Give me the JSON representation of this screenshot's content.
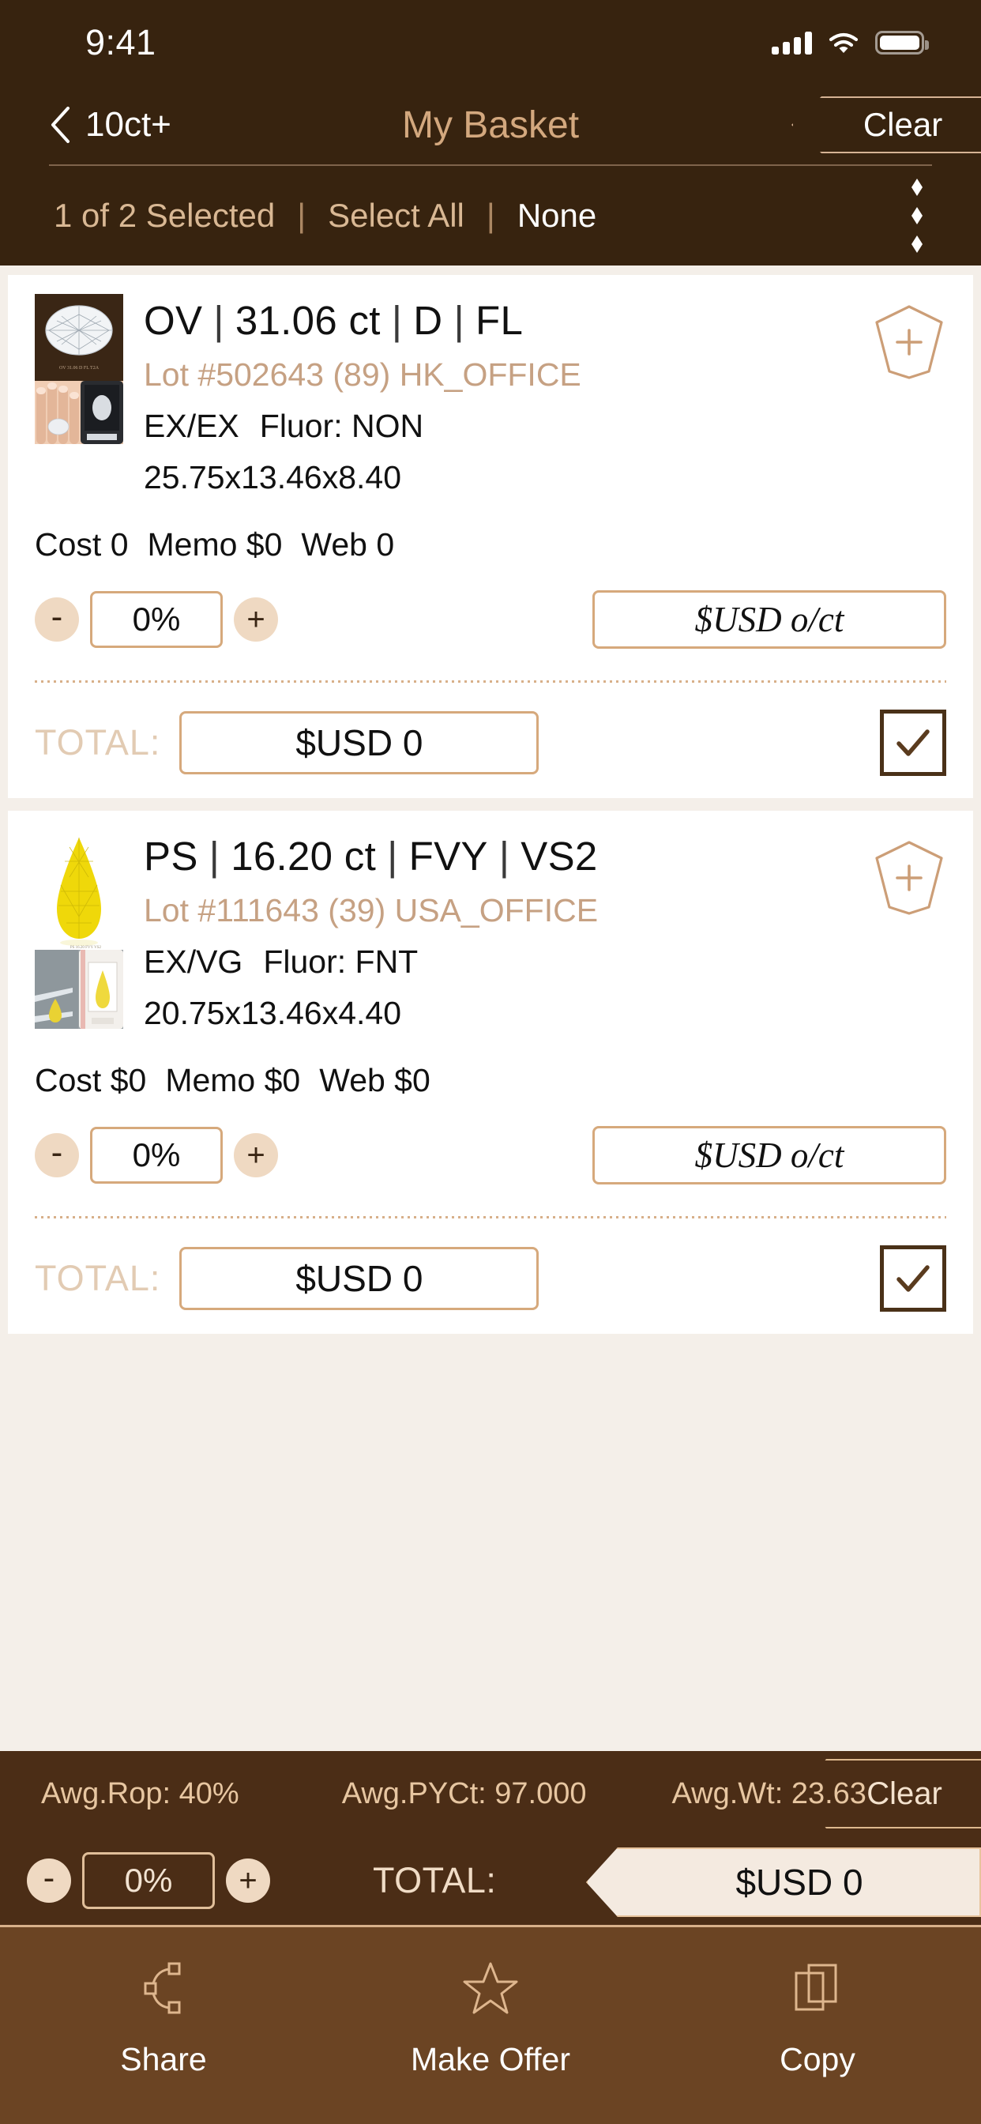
{
  "status_bar": {
    "time": "9:41",
    "signal_icon": "cellular-bars-icon",
    "wifi_icon": "wifi-icon",
    "battery_icon": "battery-icon"
  },
  "nav": {
    "back_label": "10ct+",
    "back_icon": "chevron-left-icon",
    "title": "My Basket",
    "clear_label": "Clear"
  },
  "select_bar": {
    "selected_count_label": "1 of 2 Selected",
    "separator": "|",
    "select_all_label": "Select All",
    "none_label": "None",
    "menu_icon": "kebab-diamond-menu-icon"
  },
  "cards": [
    {
      "shape": "OV",
      "carat": "31.06 ct",
      "color": "D",
      "clarity": "FL",
      "pipe": "|",
      "lot": "Lot #502643 (89) HK_OFFICE",
      "cut_polish": "EX/EX",
      "fluor": "Fluor: NON",
      "measurements": "25.75x13.46x8.40",
      "cost": "Cost 0",
      "memo": "Memo $0",
      "web": "Web 0",
      "minus": "-",
      "percent": "0%",
      "plus": "+",
      "usd_per_ct": "$USD o/ct",
      "total_label": "TOTAL:",
      "total_value": "$USD 0",
      "checked": true,
      "add_icon": "gem-plus-icon",
      "thumb_top_icon": "oval-diamond-thumbnail",
      "thumb_bottom_icon": "hand-holding-diamond-photo"
    },
    {
      "shape": "PS",
      "carat": "16.20 ct",
      "color": "FVY",
      "clarity": "VS2",
      "pipe": "|",
      "lot": "Lot #111643 (39) USA_OFFICE",
      "cut_polish": "EX/VG",
      "fluor": "Fluor: FNT",
      "measurements": "20.75x13.46x4.40",
      "cost": "Cost $0",
      "memo": "Memo $0",
      "web": "Web $0",
      "minus": "-",
      "percent": "0%",
      "plus": "+",
      "usd_per_ct": "$USD o/ct",
      "total_label": "TOTAL:",
      "total_value": "$USD 0",
      "checked": true,
      "add_icon": "gem-plus-icon",
      "thumb_top_icon": "pear-yellow-diamond-thumbnail",
      "thumb_bottom_icon": "tweezers-diamond-photo"
    }
  ],
  "summary": {
    "avg_rop": "Awg.Rop: 40%",
    "avg_pyct": "Awg.PYCt: 97.000",
    "avg_wt": "Awg.Wt: 23.63",
    "clear_label": "Clear",
    "minus": "-",
    "percent": "0%",
    "plus": "+",
    "total_label": "TOTAL:",
    "total_value": "$USD 0"
  },
  "tabs": [
    {
      "label": "Share",
      "icon": "share-nodes-icon"
    },
    {
      "label": "Make Offer",
      "icon": "star-outline-icon"
    },
    {
      "label": "Copy",
      "icon": "copy-icon"
    }
  ],
  "colors": {
    "nav_bg": "#37230F",
    "summary_bg": "#4B2D16",
    "tabbar_bg": "#6B4423",
    "page_bg": "#F4EFE9",
    "accent_tan": "#D3A87E",
    "border_tan": "#D6A97C"
  }
}
